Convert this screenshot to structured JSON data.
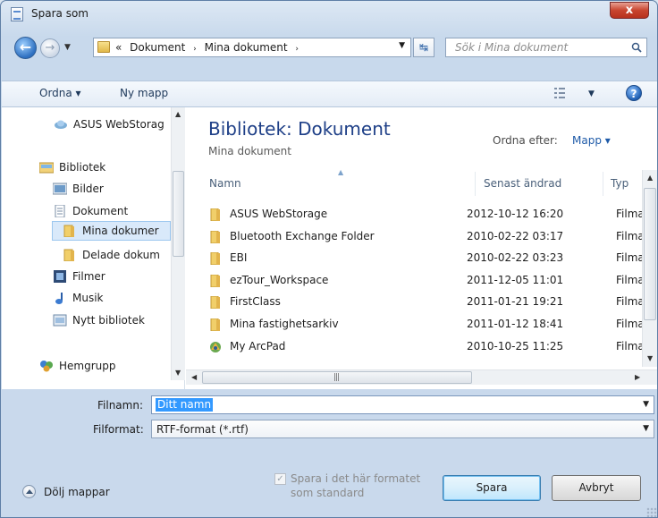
{
  "window": {
    "title": "Spara som",
    "close_glyph": "x"
  },
  "address": {
    "overflow": "«",
    "crumbs": [
      "Dokument",
      "Mina dokument"
    ],
    "separator": "›",
    "search_placeholder": "Sök i Mina dokument"
  },
  "toolbar": {
    "organize": "Ordna ▾",
    "new_folder": "Ny mapp"
  },
  "nav": {
    "items": [
      {
        "label": "ASUS WebStorag",
        "icon": "cloud-icon"
      },
      {
        "label": "Bibliotek",
        "icon": "library-icon"
      },
      {
        "label": "Bilder",
        "icon": "pictures-icon"
      },
      {
        "label": "Dokument",
        "icon": "documents-icon"
      },
      {
        "label": "Mina dokumer",
        "icon": "folder-icon"
      },
      {
        "label": "Delade dokum",
        "icon": "folder-icon"
      },
      {
        "label": "Filmer",
        "icon": "videos-icon"
      },
      {
        "label": "Musik",
        "icon": "music-icon"
      },
      {
        "label": "Nytt bibliotek",
        "icon": "library-icon"
      },
      {
        "label": "Hemgrupp",
        "icon": "homegroup-icon"
      }
    ]
  },
  "library": {
    "title": "Bibliotek: Dokument",
    "subtitle": "Mina dokument",
    "sort_label": "Ordna efter:",
    "sort_value": "Mapp ▾"
  },
  "columns": {
    "name": "Namn",
    "modified": "Senast ändrad",
    "type": "Typ"
  },
  "files": [
    {
      "name": "ASUS WebStorage",
      "date": "2012-10-12 16:20",
      "type": "Filma",
      "icon": "folder-icon"
    },
    {
      "name": "Bluetooth Exchange Folder",
      "date": "2010-02-22 03:17",
      "type": "Filma",
      "icon": "folder-icon"
    },
    {
      "name": "EBI",
      "date": "2010-02-22 03:23",
      "type": "Filma",
      "icon": "folder-icon"
    },
    {
      "name": "ezTour_Workspace",
      "date": "2011-12-05 11:01",
      "type": "Filma",
      "icon": "folder-icon"
    },
    {
      "name": "FirstClass",
      "date": "2011-01-21 19:21",
      "type": "Filma",
      "icon": "folder-icon"
    },
    {
      "name": "Mina fastighetsarkiv",
      "date": "2011-01-12 18:41",
      "type": "Filma",
      "icon": "folder-icon"
    },
    {
      "name": "My ArcPad",
      "date": "2010-10-25 11:25",
      "type": "Filma",
      "icon": "arcpad-icon"
    }
  ],
  "form": {
    "filename_label": "Filnamn:",
    "filename_value": "Ditt namn",
    "format_label": "Filformat:",
    "format_value": "RTF-format (*.rtf)"
  },
  "footer": {
    "hide_folders": "Dölj mappar",
    "save_as_default_line1": "Spara i det här formatet",
    "save_as_default_line2": "som standard",
    "save": "Spara",
    "cancel": "Avbryt"
  }
}
